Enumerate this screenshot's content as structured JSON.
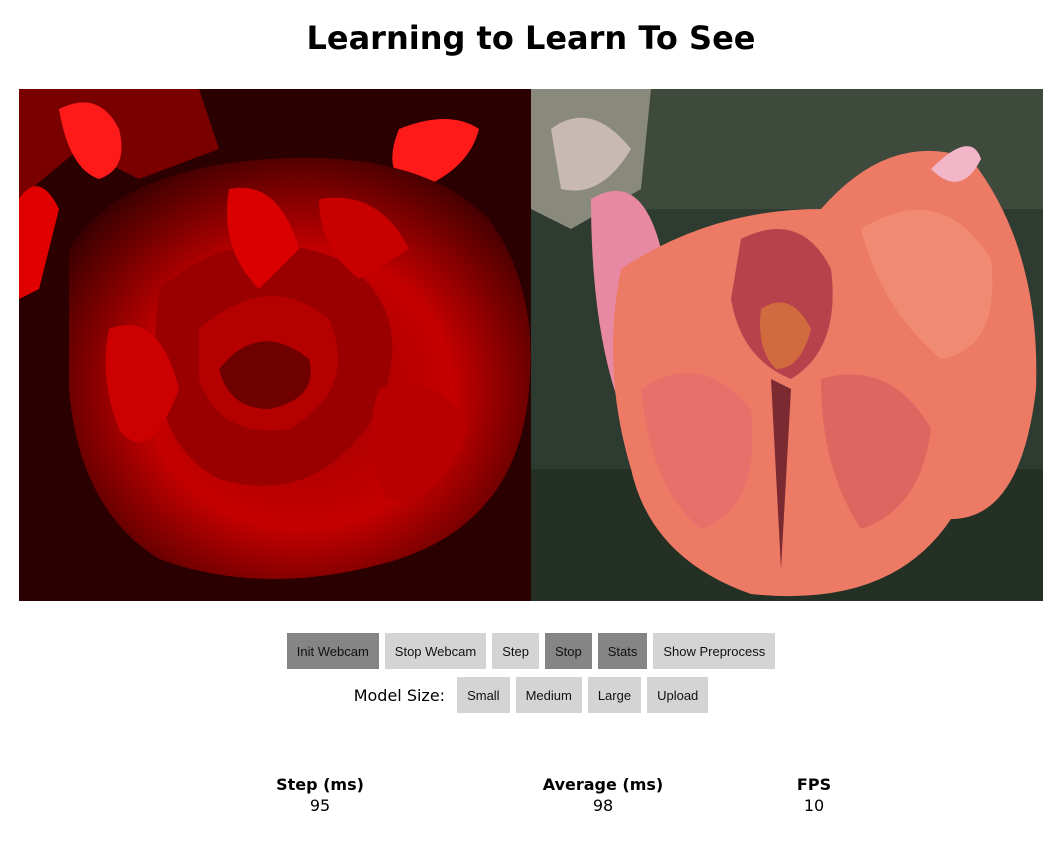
{
  "page": {
    "title": "Learning to Learn To See"
  },
  "images": {
    "input": {
      "description_icon": "webcam-input-image",
      "dominant_color": "#d20000"
    },
    "output": {
      "description_icon": "generated-flower-image",
      "dominant_color": "#e8725f"
    }
  },
  "controls": {
    "row1": [
      {
        "label": "Init Webcam",
        "active": true
      },
      {
        "label": "Stop Webcam",
        "active": false
      },
      {
        "label": "Step",
        "active": false
      },
      {
        "label": "Stop",
        "active": true
      },
      {
        "label": "Stats",
        "active": true
      },
      {
        "label": "Show Preprocess",
        "active": false
      }
    ],
    "model_size_label": "Model Size:",
    "row2": [
      {
        "label": "Small"
      },
      {
        "label": "Medium"
      },
      {
        "label": "Large"
      },
      {
        "label": "Upload"
      }
    ]
  },
  "stats": {
    "step": {
      "label": "Step (ms)",
      "value": "95"
    },
    "average": {
      "label": "Average (ms)",
      "value": "98"
    },
    "fps": {
      "label": "FPS",
      "value": "10"
    }
  },
  "colors": {
    "button_active": "#858585",
    "button_inactive": "#d4d4d4"
  }
}
